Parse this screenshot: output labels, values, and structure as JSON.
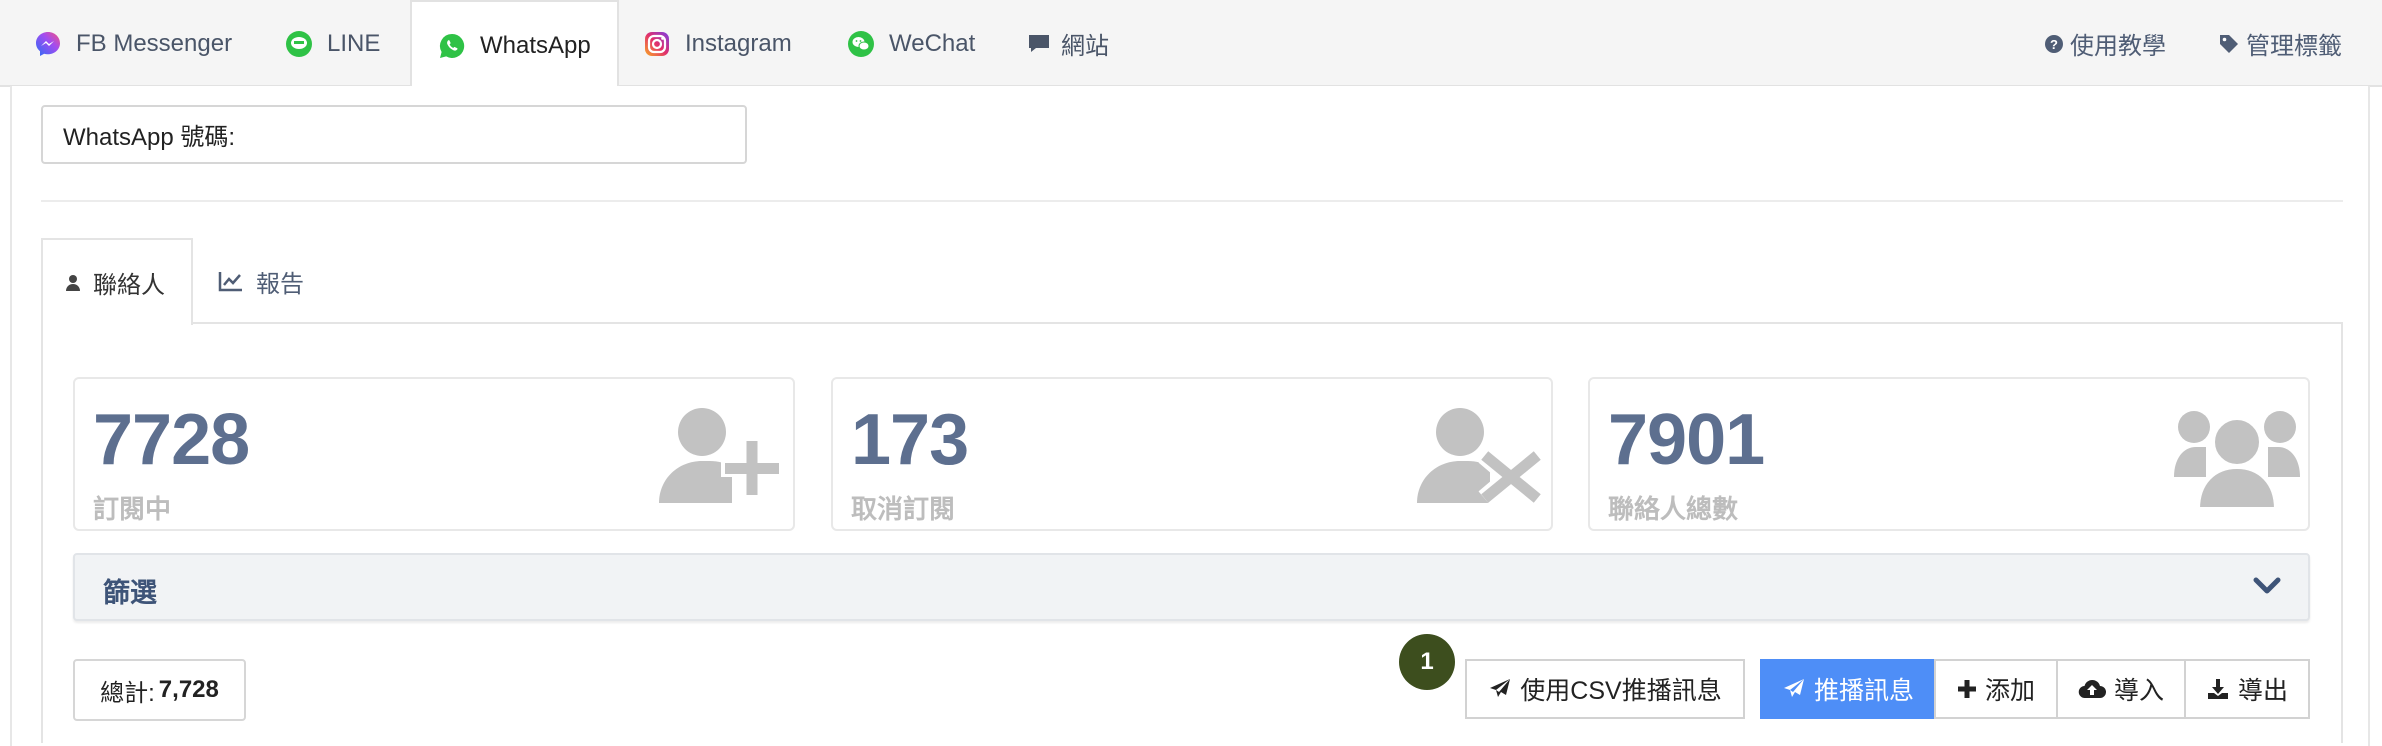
{
  "channels": [
    {
      "label": "FB Messenger",
      "icon": "messenger-icon"
    },
    {
      "label": "LINE",
      "icon": "line-icon"
    },
    {
      "label": "WhatsApp",
      "icon": "whatsapp-icon",
      "active": true
    },
    {
      "label": "Instagram",
      "icon": "instagram-icon"
    },
    {
      "label": "WeChat",
      "icon": "wechat-icon"
    },
    {
      "label": "網站",
      "icon": "chat-bubble-icon"
    }
  ],
  "header_links": {
    "tutorial": "使用教學",
    "manage_tags": "管理標籤"
  },
  "whatsapp_number_label": "WhatsApp 號碼:",
  "subtabs": {
    "contacts": "聯絡人",
    "report": "報告"
  },
  "stats": [
    {
      "value": "7728",
      "label": "訂閱中",
      "icon": "user-plus-icon"
    },
    {
      "value": "173",
      "label": "取消訂閱",
      "icon": "user-times-icon"
    },
    {
      "value": "7901",
      "label": "聯絡人總數",
      "icon": "users-icon"
    }
  ],
  "filter": {
    "title": "篩選"
  },
  "total": {
    "label": "總計:",
    "value": "7,728"
  },
  "badge": "1",
  "actions": {
    "csv_broadcast": "使用CSV推播訊息",
    "broadcast": "推播訊息",
    "add": "添加",
    "import": "導入",
    "export": "導出"
  },
  "colors": {
    "primary": "#4e8ef7",
    "stat_number": "#5d6f8f",
    "filter_title": "#3e5478",
    "badge": "#3d4e1e"
  }
}
